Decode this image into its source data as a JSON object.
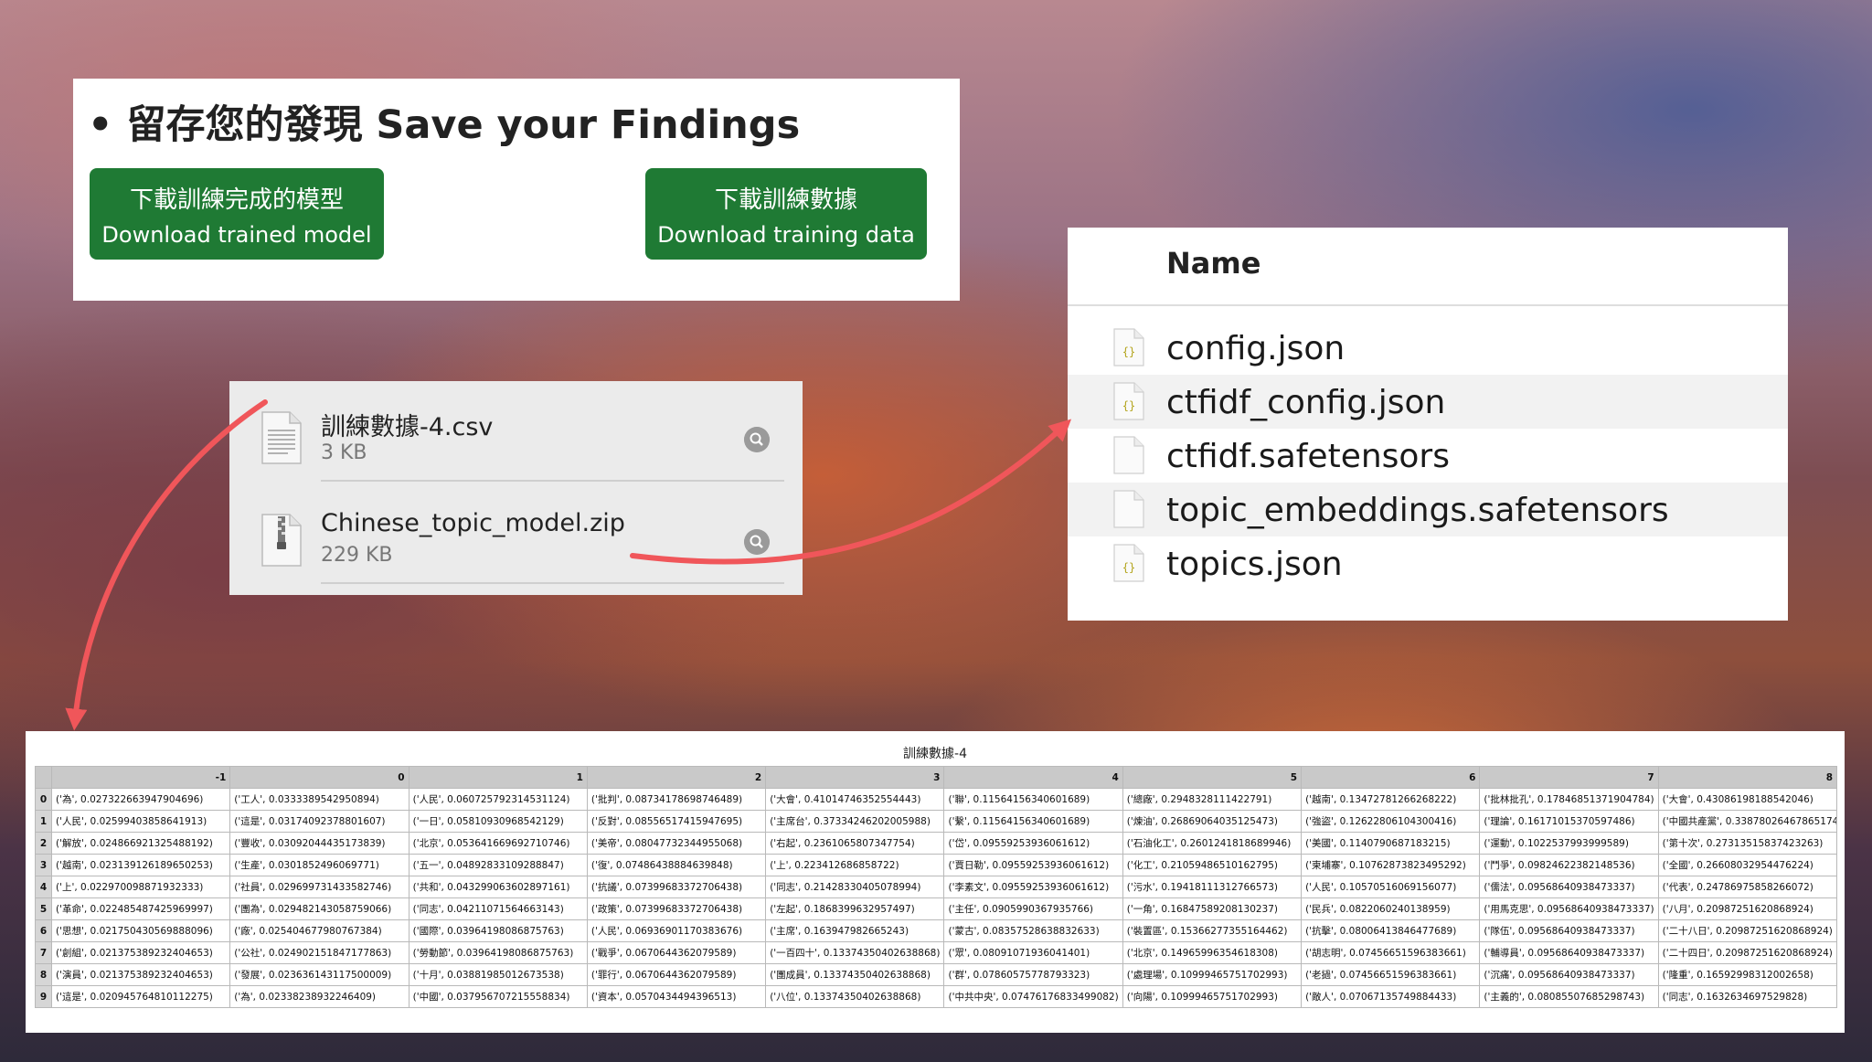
{
  "save_panel": {
    "title": "• 留存您的發現 Save your Findings",
    "buttons": [
      {
        "zh": "下載訓練完成的模型",
        "en": "Download trained model"
      },
      {
        "zh": "下載訓練數據",
        "en": "Download training data"
      }
    ],
    "button_color": "#1f7a34"
  },
  "downloads": {
    "items": [
      {
        "name": "訓練數據-4.csv",
        "size": "3 KB"
      },
      {
        "name": "Chinese_topic_model.zip",
        "size": "229 KB"
      }
    ]
  },
  "finder": {
    "column_header": "Name",
    "files": [
      {
        "name": "config.json",
        "icon": "json-file-icon"
      },
      {
        "name": "ctfidf_config.json",
        "icon": "json-file-icon"
      },
      {
        "name": "ctfidf.safetensors",
        "icon": "blank-file-icon"
      },
      {
        "name": "topic_embeddings.safetensors",
        "icon": "blank-file-icon"
      },
      {
        "name": "topics.json",
        "icon": "json-file-icon"
      }
    ]
  },
  "table": {
    "title": "訓練數據-4",
    "columns": [
      "-1",
      "0",
      "1",
      "2",
      "3",
      "4",
      "5",
      "6",
      "7",
      "8"
    ],
    "rows": [
      {
        "index": "0",
        "cells": [
          "('為', 0.027322663947904696)",
          "('工人', 0.0333389542950894)",
          "('人民', 0.060725792314531124)",
          "('批判', 0.08734178698746489)",
          "('大會', 0.41014746352554443)",
          "('聯', 0.11564156340601689)",
          "('總廠', 0.2948328111422791)",
          "('越南', 0.13472781266268222)",
          "('批林批孔', 0.17846851371904784)",
          "('大會', 0.43086198188542046)"
        ]
      },
      {
        "index": "1",
        "cells": [
          "('人民', 0.02599403858641913)",
          "('這是', 0.03174092378801607)",
          "('一日', 0.05810930968542129)",
          "('反對', 0.08556517415947695)",
          "('主席台', 0.37334246202005988)",
          "('繫', 0.11564156340601689)",
          "('煉油', 0.26869064035125473)",
          "('強盜', 0.12622806104300416)",
          "('理論', 0.16171015370597486)",
          "('中國共產黨', 0.33878026467865174)"
        ]
      },
      {
        "index": "2",
        "cells": [
          "('解放', 0.024866921325488192)",
          "('豐收', 0.03092044435173839)",
          "('北京', 0.053641669692710746)",
          "('美帝', 0.08047732344955068)",
          "('右起', 0.2361065807347754)",
          "('岱', 0.09559253936061612)",
          "('石油化工', 0.2601241818689946)",
          "('美國', 0.1140790687183215)",
          "('運動', 0.1022537993999589)",
          "('第十次', 0.27313515837423263)"
        ]
      },
      {
        "index": "3",
        "cells": [
          "('越南', 0.023139126189650253)",
          "('生產', 0.0301852496069771)",
          "('五一', 0.04892833109288847)",
          "('復', 0.07486438884639848)",
          "('上', 0.223412686858722)",
          "('賈日勒', 0.09559253936061612)",
          "('化工', 0.21059486510162795)",
          "('柬埔寨', 0.10762873823495292)",
          "('鬥爭', 0.09824622382148536)",
          "('全國', 0.26608032954476224)"
        ]
      },
      {
        "index": "4",
        "cells": [
          "('上', 0.022970098871932333)",
          "('社員', 0.029699731433582746)",
          "('共和', 0.043299063602897161)",
          "('抗議', 0.07399683372706438)",
          "('同志', 0.21428330405078994)",
          "('李素文', 0.09559253936061612)",
          "('污水', 0.19418111312766573)",
          "('人民', 0.10570516069156077)",
          "('儒法', 0.09568640938473337)",
          "('代表', 0.24786975858266072)"
        ]
      },
      {
        "index": "5",
        "cells": [
          "('革命', 0.022485487425969997)",
          "('團為', 0.029482143058759066)",
          "('同志', 0.04211071564663143)",
          "('政策', 0.07399683372706438)",
          "('左起', 0.1868399632957497)",
          "('主任', 0.0905990367935766)",
          "('一角', 0.16847589208130237)",
          "('民兵', 0.0822060240138959)",
          "('用馬克思', 0.09568640938473337)",
          "('八月', 0.20987251620868924)"
        ]
      },
      {
        "index": "6",
        "cells": [
          "('思想', 0.021750430569888096)",
          "('廠', 0.025404677980767384)",
          "('國際', 0.03964198086875763)",
          "('人民', 0.06936901170383676)",
          "('主席', 0.163947982665243)",
          "('蒙古', 0.08357528638832633)",
          "('裝置區', 0.15366277355164462)",
          "('抗擊', 0.08006413846477689)",
          "('隊伍', 0.09568640938473337)",
          "('二十八日', 0.20987251620868924)"
        ]
      },
      {
        "index": "7",
        "cells": [
          "('創組', 0.021375389232404653)",
          "('公社', 0.024902151847177863)",
          "('勞動節', 0.03964198086875763)",
          "('戰爭', 0.0670644362079589)",
          "('一百四十', 0.13374350402638868)",
          "('眾', 0.08091071936041401)",
          "('北京', 0.14965996354618308)",
          "('胡志明', 0.07456651596383661)",
          "('輔導員', 0.09568640938473337)",
          "('二十四日', 0.20987251620868924)"
        ]
      },
      {
        "index": "8",
        "cells": [
          "('演員', 0.021375389232404653)",
          "('發展', 0.023636143117500009)",
          "('十月', 0.03881985012673538)",
          "('罪行', 0.0670644362079589)",
          "('團成員', 0.13374350402638868)",
          "('群', 0.07860575778793323)",
          "('處理場', 0.10999465751702993)",
          "('老撾', 0.07456651596383661)",
          "('沉痛', 0.09568640938473337)",
          "('隆重', 0.16592998312002658)"
        ]
      },
      {
        "index": "9",
        "cells": [
          "('這是', 0.020945764810112275)",
          "('為', 0.02338238932246409)",
          "('中國', 0.037956707215558834)",
          "('資本', 0.0570434494396513)",
          "('八位', 0.13374350402638868)",
          "('中共中央', 0.07476176833499082)",
          "('向陽', 0.10999465751702993)",
          "('敵人', 0.07067135749884433)",
          "('主義的', 0.08085507685298743)",
          "('同志', 0.1632634697529828)"
        ]
      }
    ]
  },
  "arrow_color": "#f0565a"
}
